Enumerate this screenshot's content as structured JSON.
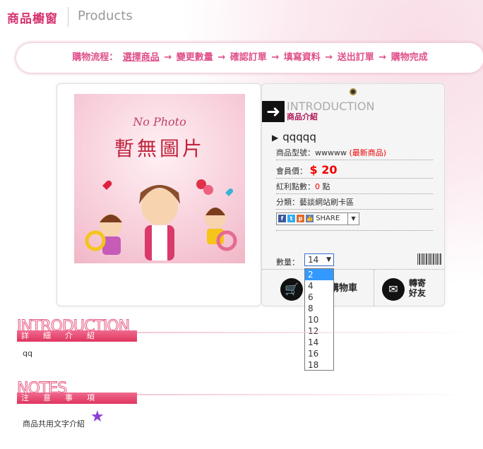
{
  "header": {
    "title_cn": "商品櫥窗",
    "title_en": "Products"
  },
  "flow": {
    "label": "購物流程：",
    "steps": [
      "選擇商品",
      "變更數量",
      "確認訂單",
      "填寫資料",
      "送出訂單",
      "購物完成"
    ],
    "arrow": "→"
  },
  "photo": {
    "line1": "No Photo",
    "line2": "暫無圖片"
  },
  "intro": {
    "en": "INTRODUCTION",
    "cn": "商品介紹"
  },
  "product": {
    "name": "qqqqq",
    "model_label": "商品型號：",
    "model": "wwwww",
    "model_tag": "(最新商品)",
    "price_label": "會員價：",
    "price": "$ 20",
    "points_label": "紅利點數：",
    "points": "0",
    "points_unit": "點",
    "category_label": "分類：",
    "category": "藝談網站刷卡區"
  },
  "share": {
    "label": "SHARE"
  },
  "quantity": {
    "label": "數量：",
    "value": "14",
    "options": [
      "2",
      "4",
      "6",
      "8",
      "10",
      "12",
      "14",
      "16",
      "18"
    ],
    "highlighted": "2"
  },
  "actions": {
    "cart": "購物車",
    "forward_line1": "轉寄",
    "forward_line2": "好友"
  },
  "sections": {
    "detail": {
      "en": "INTRODUCTION",
      "cn": "詳細介紹",
      "body": "qq"
    },
    "notes": {
      "en": "NOTES",
      "cn": "注意事項",
      "body": "商品共用文字介紹"
    }
  }
}
